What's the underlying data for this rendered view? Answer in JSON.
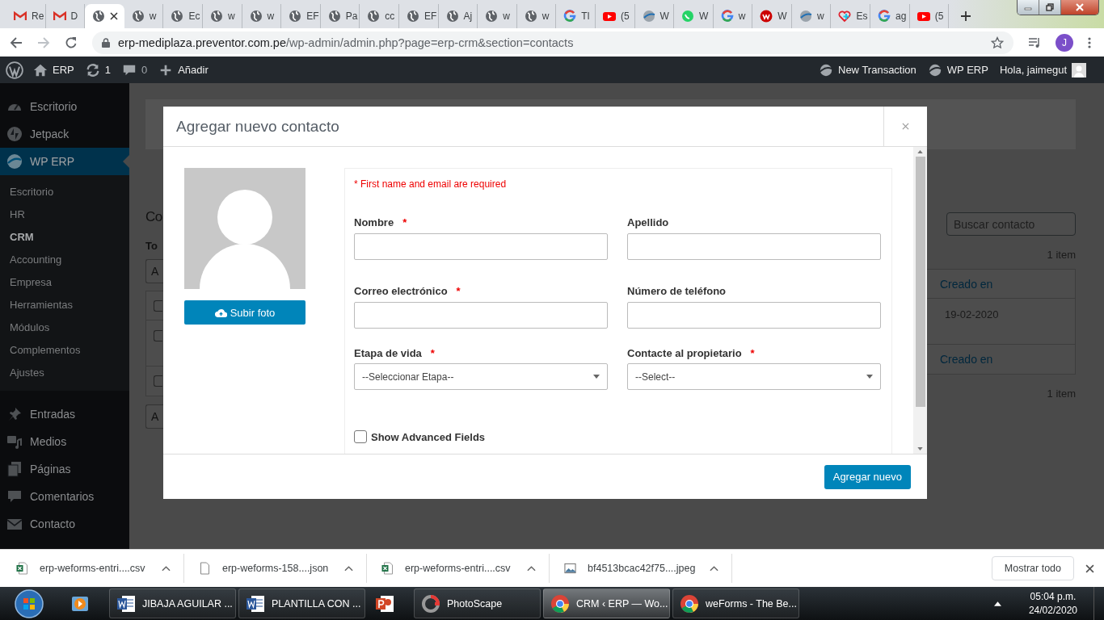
{
  "browser": {
    "tabs": [
      {
        "title": "Re",
        "kind": "gmail",
        "selected": false
      },
      {
        "title": "D",
        "kind": "gmail",
        "selected": false
      },
      {
        "kind": "globe",
        "selected": true
      },
      {
        "title": "w",
        "kind": "globe",
        "selected": false
      },
      {
        "title": "Ec",
        "kind": "globe",
        "selected": false
      },
      {
        "title": "w",
        "kind": "globe",
        "selected": false
      },
      {
        "title": "w",
        "kind": "globe",
        "selected": false
      },
      {
        "title": "EF",
        "kind": "globe",
        "selected": false
      },
      {
        "title": "Pa",
        "kind": "globe",
        "selected": false
      },
      {
        "title": "cc",
        "kind": "globe",
        "selected": false
      },
      {
        "title": "EF",
        "kind": "globe",
        "selected": false
      },
      {
        "title": "Aj",
        "kind": "globe",
        "selected": false
      },
      {
        "title": "w",
        "kind": "globe",
        "selected": false
      },
      {
        "title": "w",
        "kind": "globe",
        "selected": false
      },
      {
        "title": "Tl",
        "kind": "google",
        "selected": false
      },
      {
        "title": "(5",
        "kind": "youtube",
        "selected": false
      },
      {
        "title": "W",
        "kind": "erp",
        "selected": false
      },
      {
        "title": "W",
        "kind": "whatsapp",
        "selected": false
      },
      {
        "title": "w",
        "kind": "google",
        "selected": false
      },
      {
        "title": "W",
        "kind": "weforms",
        "selected": false
      },
      {
        "title": "w",
        "kind": "erp",
        "selected": false
      },
      {
        "title": "Es",
        "kind": "health",
        "selected": false
      },
      {
        "title": "ag",
        "kind": "google",
        "selected": false
      },
      {
        "title": "(5",
        "kind": "youtube",
        "selected": false
      }
    ],
    "url_host": "erp-mediplaza.preventor.com.pe",
    "url_path": "/wp-admin/admin.php?page=erp-crm&section=contacts",
    "profile_initial": "J"
  },
  "admin_bar": {
    "site": "ERP",
    "updates": "1",
    "comments": "0",
    "new": "Añadir",
    "right": [
      "New Transaction",
      "WP ERP"
    ],
    "greeting": "Hola, jaimegut"
  },
  "sidebar": {
    "top": [
      {
        "label": "Escritorio",
        "kind": "dashboard",
        "selected": false
      },
      {
        "label": "Jetpack",
        "kind": "jetpack",
        "selected": false
      },
      {
        "label": "WP ERP",
        "kind": "erp",
        "selected": true
      }
    ],
    "submenu": [
      {
        "label": "Escritorio",
        "selected": false
      },
      {
        "label": "HR",
        "selected": false
      },
      {
        "label": "CRM",
        "selected": true
      },
      {
        "label": "Accounting",
        "selected": false
      },
      {
        "label": "Empresa",
        "selected": false
      },
      {
        "label": "Herramientas",
        "selected": false
      },
      {
        "label": "Módulos",
        "selected": false
      },
      {
        "label": "Complementos",
        "selected": false
      },
      {
        "label": "Ajustes",
        "selected": false
      }
    ],
    "bottom": [
      {
        "label": "Entradas",
        "kind": "pin"
      },
      {
        "label": "Medios",
        "kind": "media"
      },
      {
        "label": "Páginas",
        "kind": "pages"
      },
      {
        "label": "Comentarios",
        "kind": "comments"
      },
      {
        "label": "Contacto",
        "kind": "mail"
      }
    ]
  },
  "page": {
    "heading": "Co",
    "filter": "To",
    "bulk_selects": [
      "A",
      "A"
    ],
    "search_placeholder": "Buscar contacto",
    "count_top": "1 item",
    "count_bottom": "1 item",
    "table": {
      "header": {
        "created": "Creado en",
        "checked": false
      },
      "rows": [
        {
          "created": "19-02-2020",
          "checked": false
        }
      ],
      "footer": {
        "created": "Creado en",
        "checked": false
      }
    }
  },
  "modal": {
    "title": "Agregar nuevo contacto",
    "upload_button": "Subir foto",
    "required_note": "* First name and email are required",
    "fields": [
      {
        "kind": "text",
        "label": "Nombre",
        "required_mark": "*"
      },
      {
        "kind": "text",
        "label": "Apellido"
      },
      {
        "kind": "text",
        "label": "Correo electrónico",
        "required_mark": "*"
      },
      {
        "kind": "text",
        "label": "Número de teléfono"
      },
      {
        "kind": "select",
        "label": "Etapa de vida",
        "required_mark": "*",
        "value": "--Seleccionar Etapa--"
      },
      {
        "kind": "select",
        "label": "Contacte al propietario",
        "required_mark": "*",
        "value": "--Select--"
      }
    ],
    "advanced": {
      "label": "Show Advanced Fields",
      "checked": false
    },
    "submit": "Agregar nuevo"
  },
  "downloads": {
    "items": [
      {
        "name": "erp-weforms-entri....csv",
        "kind": "excel"
      },
      {
        "name": "erp-weforms-158....json",
        "kind": "file"
      },
      {
        "name": "erp-weforms-entri....csv",
        "kind": "excel"
      },
      {
        "name": "bf4513bcac42f75....jpeg",
        "kind": "image"
      }
    ],
    "show_all": "Mostrar todo"
  },
  "taskbar": {
    "tasks": [
      {
        "kind": "media",
        "selected": false
      },
      {
        "kind": "word",
        "title": "JIBAJA AGUILAR ...",
        "selected": false
      },
      {
        "kind": "word",
        "title": "PLANTILLA CON ...",
        "selected": false
      },
      {
        "kind": "powerpoint",
        "selected": false
      },
      {
        "kind": "photoscape",
        "title": "PhotoScape",
        "selected": false
      },
      {
        "kind": "chrome",
        "title": "CRM ‹ ERP — Wo...",
        "selected": true
      },
      {
        "kind": "chrome",
        "title": "weForms - The Be...",
        "selected": false
      }
    ],
    "time": "05:04 p.m.",
    "date": "24/02/2020"
  }
}
